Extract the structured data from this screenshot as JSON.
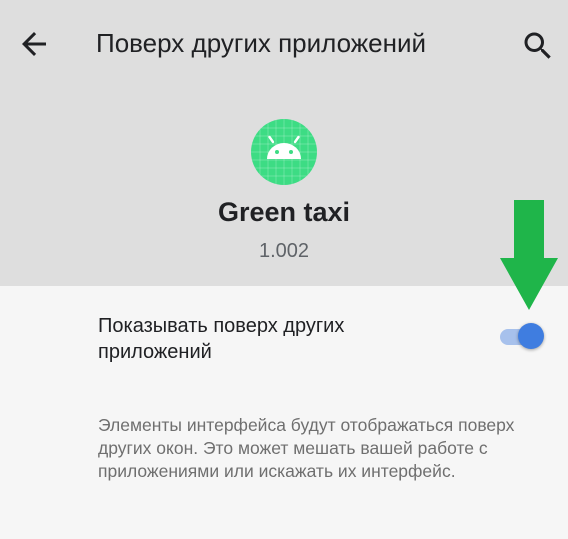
{
  "toolbar": {
    "title": "Поверх других приложений",
    "back_icon": "arrow-back-icon",
    "search_icon": "search-icon"
  },
  "app": {
    "name": "Green taxi",
    "version": "1.002",
    "icon": "android-icon",
    "icon_color": "#3ddc84"
  },
  "setting": {
    "label": "Показывать поверх других приложений",
    "enabled": true,
    "accent_color": "#3f7de0"
  },
  "description": "Элементы интерфейса будут отображаться поверх других окон. Это может мешать вашей работе с приложениями или искажать их интерфейс.",
  "annotation": {
    "arrow_icon": "arrow-down-icon",
    "arrow_color": "#1fb54a"
  }
}
